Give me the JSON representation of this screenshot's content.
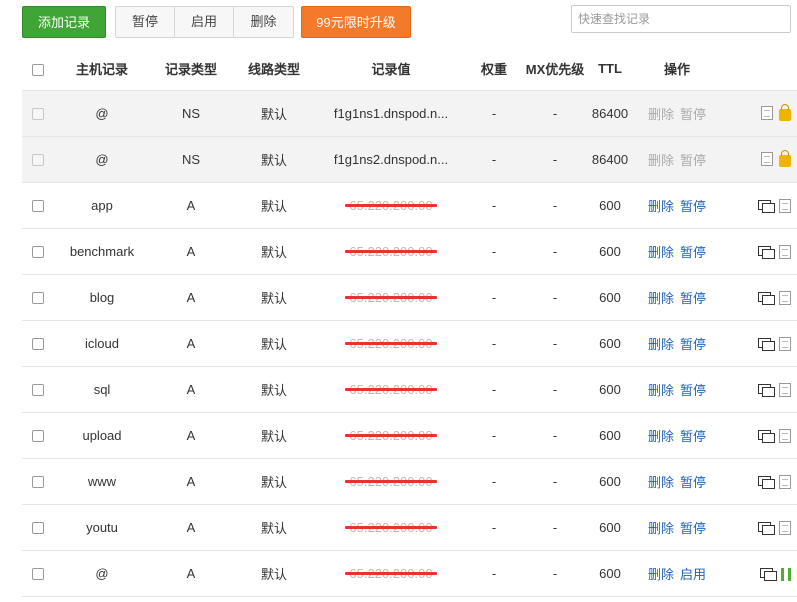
{
  "toolbar": {
    "add_label": "添加记录",
    "pause_label": "暂停",
    "enable_label": "启用",
    "delete_label": "删除",
    "upgrade_label": "99元限时升级",
    "search_placeholder": "快速查找记录"
  },
  "table": {
    "headers": {
      "host": "主机记录",
      "type": "记录类型",
      "line": "线路类型",
      "value": "记录值",
      "weight": "权重",
      "mx": "MX优先级",
      "ttl": "TTL",
      "ops": "操作"
    },
    "rows": [
      {
        "host": "@",
        "type": "NS",
        "line": "默认",
        "value": "f1g1ns1.dnspod.n...",
        "redacted": false,
        "weight": "-",
        "mx": "-",
        "ttl": "86400",
        "delete": "删除",
        "toggle": "暂停",
        "system": true,
        "actions_disabled": true,
        "icon_b": "lock-icon"
      },
      {
        "host": "@",
        "type": "NS",
        "line": "默认",
        "value": "f1g1ns2.dnspod.n...",
        "redacted": false,
        "weight": "-",
        "mx": "-",
        "ttl": "86400",
        "delete": "删除",
        "toggle": "暂停",
        "system": true,
        "actions_disabled": true,
        "icon_b": "lock-icon"
      },
      {
        "host": "app",
        "type": "A",
        "line": "默认",
        "value": "65.220.200.00",
        "redacted": true,
        "weight": "-",
        "mx": "-",
        "ttl": "600",
        "delete": "删除",
        "toggle": "暂停",
        "system": false,
        "actions_disabled": false,
        "icon_b": "note-icon"
      },
      {
        "host": "benchmark",
        "type": "A",
        "line": "默认",
        "value": "65.220.200.00",
        "redacted": true,
        "weight": "-",
        "mx": "-",
        "ttl": "600",
        "delete": "删除",
        "toggle": "暂停",
        "system": false,
        "actions_disabled": false,
        "icon_b": "note-icon"
      },
      {
        "host": "blog",
        "type": "A",
        "line": "默认",
        "value": "65.220.200.00",
        "redacted": true,
        "weight": "-",
        "mx": "-",
        "ttl": "600",
        "delete": "删除",
        "toggle": "暂停",
        "system": false,
        "actions_disabled": false,
        "icon_b": "note-icon"
      },
      {
        "host": "icloud",
        "type": "A",
        "line": "默认",
        "value": "65.220.200.00",
        "redacted": true,
        "weight": "-",
        "mx": "-",
        "ttl": "600",
        "delete": "删除",
        "toggle": "暂停",
        "system": false,
        "actions_disabled": false,
        "icon_b": "note-icon"
      },
      {
        "host": "sql",
        "type": "A",
        "line": "默认",
        "value": "65.220.200.00",
        "redacted": true,
        "weight": "-",
        "mx": "-",
        "ttl": "600",
        "delete": "删除",
        "toggle": "暂停",
        "system": false,
        "actions_disabled": false,
        "icon_b": "note-icon"
      },
      {
        "host": "upload",
        "type": "A",
        "line": "默认",
        "value": "65.220.200.00",
        "redacted": true,
        "weight": "-",
        "mx": "-",
        "ttl": "600",
        "delete": "删除",
        "toggle": "暂停",
        "system": false,
        "actions_disabled": false,
        "icon_b": "note-icon"
      },
      {
        "host": "www",
        "type": "A",
        "line": "默认",
        "value": "65.220.200.00",
        "redacted": true,
        "weight": "-",
        "mx": "-",
        "ttl": "600",
        "delete": "删除",
        "toggle": "暂停",
        "system": false,
        "actions_disabled": false,
        "icon_b": "note-icon"
      },
      {
        "host": "youtu",
        "type": "A",
        "line": "默认",
        "value": "65.220.200.00",
        "redacted": true,
        "weight": "-",
        "mx": "-",
        "ttl": "600",
        "delete": "删除",
        "toggle": "暂停",
        "system": false,
        "actions_disabled": false,
        "icon_b": "note-icon"
      },
      {
        "host": "@",
        "type": "A",
        "line": "默认",
        "value": "65.220.200.00",
        "redacted": true,
        "weight": "-",
        "mx": "-",
        "ttl": "600",
        "delete": "删除",
        "toggle": "启用",
        "system": false,
        "actions_disabled": false,
        "paused": true,
        "icon_b": "note-icon"
      }
    ]
  },
  "colors": {
    "add_button": "#3fa535",
    "upgrade_button": "#f5792a",
    "link": "#1e63b5",
    "redaction": "#e8322b",
    "paused_icon": "#4caf2e"
  }
}
